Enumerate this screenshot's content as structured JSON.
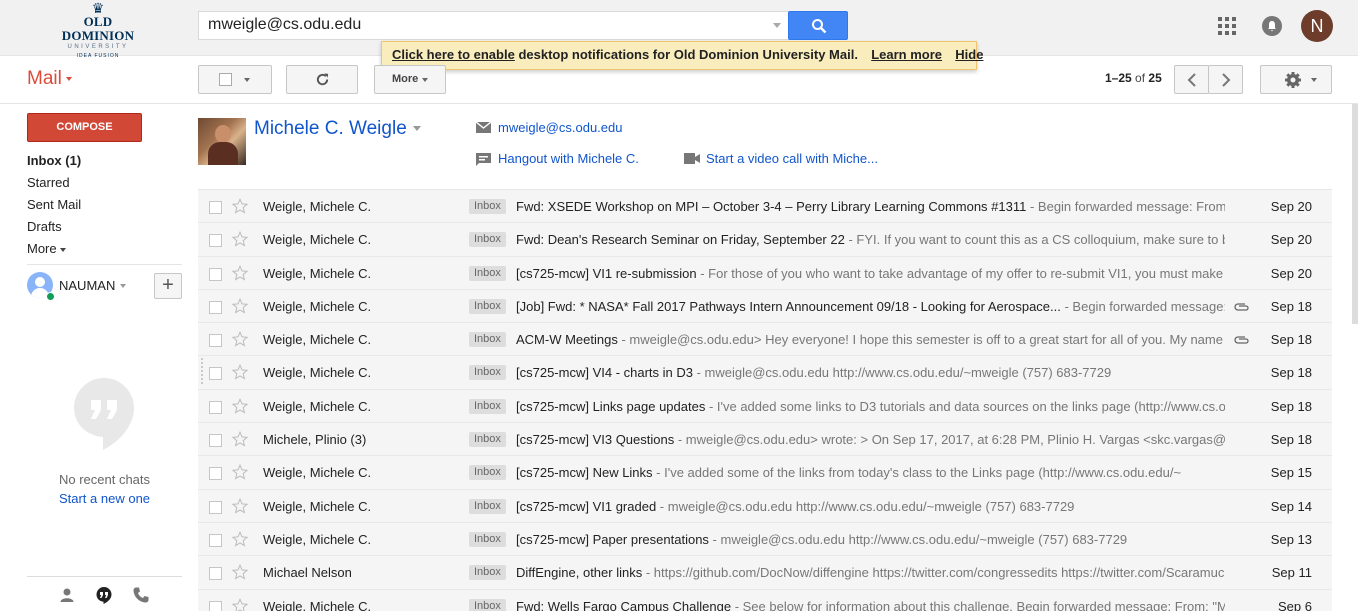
{
  "logo": {
    "line1": "OLD DOMINION",
    "line2": "UNIVERSITY",
    "line3": "IDEA FUSION"
  },
  "search": {
    "query": "mweigle@cs.odu.edu"
  },
  "account": {
    "initial": "N"
  },
  "notice": {
    "enable_link": "Click here to enable",
    "text": "desktop notifications for Old Dominion University Mail.",
    "learn_more": "Learn more",
    "hide": "Hide"
  },
  "toolbar": {
    "mail_label": "Mail",
    "more_label": "More",
    "pager_range": "1–25",
    "pager_of": "of",
    "pager_total": "25"
  },
  "sidebar": {
    "compose": "COMPOSE",
    "items": [
      {
        "label": "Inbox (1)",
        "active": true
      },
      {
        "label": "Starred"
      },
      {
        "label": "Sent Mail"
      },
      {
        "label": "Drafts"
      },
      {
        "label": "More"
      }
    ],
    "hangouts_user": "NAUMAN",
    "no_chats": "No recent chats",
    "start_new": "Start a new one"
  },
  "contact": {
    "name": "Michele C. Weigle",
    "email": "mweigle@cs.odu.edu",
    "hangout": "Hangout with Michele C.",
    "video": "Start a video call with Miche..."
  },
  "messages": [
    {
      "sender": "Weigle, Michele C.",
      "label": "Inbox",
      "subject": "Fwd: XSEDE Workshop on MPI – October 3-4 – Perry Library Learning Commons #1311",
      "snippet": " - Begin forwarded message: From: \"",
      "date": "Sep 20",
      "attachment": false
    },
    {
      "sender": "Weigle, Michele C.",
      "label": "Inbox",
      "subject": "Fwd: Dean's Research Seminar on Friday, September 22",
      "snippet": " - FYI. If you want to count this as a CS colloquium, make sure to bri",
      "date": "Sep 20",
      "attachment": false
    },
    {
      "sender": "Weigle, Michele C.",
      "label": "Inbox",
      "subject": "[cs725-mcw] VI1 re-submission",
      "snippet": " - For those of you who want to take advantage of my offer to re-submit VI1, you must make a",
      "date": "Sep 20",
      "attachment": false
    },
    {
      "sender": "Weigle, Michele C.",
      "label": "Inbox",
      "subject": "[Job] Fwd: * NASA* Fall 2017 Pathways Intern Announcement 09/18 - Looking for Aerospace...",
      "snippet": " - Begin forwarded message: F",
      "date": "Sep 18",
      "attachment": true
    },
    {
      "sender": "Weigle, Michele C.",
      "label": "Inbox",
      "subject": "ACM-W Meetings",
      "snippet": " - mweigle@cs.odu.edu> Hey everyone! I hope this semester is off to a great start for all of you. My name is",
      "date": "Sep 18",
      "attachment": true
    },
    {
      "sender": "Weigle, Michele C.",
      "label": "Inbox",
      "subject": "[cs725-mcw] VI4 - charts in D3",
      "snippet": " - mweigle@cs.odu.edu http://www.cs.odu.edu/~mweigle (757) 683-7729",
      "date": "Sep 18",
      "attachment": false
    },
    {
      "sender": "Weigle, Michele C.",
      "label": "Inbox",
      "subject": "[cs725-mcw] Links page updates",
      "snippet": " - I've added some links to D3 tutorials and data sources on the links page (http://www.cs.odu",
      "date": "Sep 18",
      "attachment": false
    },
    {
      "sender": "Michele, Plinio (3)",
      "label": "Inbox",
      "subject": "[cs725-mcw] VI3 Questions",
      "snippet": " - mweigle@cs.odu.edu> wrote: > On Sep 17, 2017, at 6:28 PM, Plinio H. Vargas <skc.vargas@gr",
      "date": "Sep 18",
      "attachment": false
    },
    {
      "sender": "Weigle, Michele C.",
      "label": "Inbox",
      "subject": "[cs725-mcw] New Links",
      "snippet": " - I've added some of the links from today's class to the Links page (http://www.cs.odu.edu/~",
      "date": "Sep 15",
      "attachment": false
    },
    {
      "sender": "Weigle, Michele C.",
      "label": "Inbox",
      "subject": "[cs725-mcw] VI1 graded",
      "snippet": " - mweigle@cs.odu.edu http://www.cs.odu.edu/~mweigle (757) 683-7729",
      "date": "Sep 14",
      "attachment": false
    },
    {
      "sender": "Weigle, Michele C.",
      "label": "Inbox",
      "subject": "[cs725-mcw] Paper presentations",
      "snippet": " - mweigle@cs.odu.edu http://www.cs.odu.edu/~mweigle (757) 683-7729",
      "date": "Sep 13",
      "attachment": false
    },
    {
      "sender": "Michael Nelson",
      "label": "Inbox",
      "subject": "DiffEngine, other links",
      "snippet": " - https://github.com/DocNow/diffengine https://twitter.com/congressedits https://twitter.com/Scaramucci",
      "date": "Sep 11",
      "attachment": false
    },
    {
      "sender": "Weigle, Michele C.",
      "label": "Inbox",
      "subject": "Fwd: Wells Fargo Campus Challenge",
      "snippet": " - See below for information about this challenge. Begin forwarded message: From: \"Mul",
      "date": "Sep 6",
      "attachment": false
    }
  ]
}
